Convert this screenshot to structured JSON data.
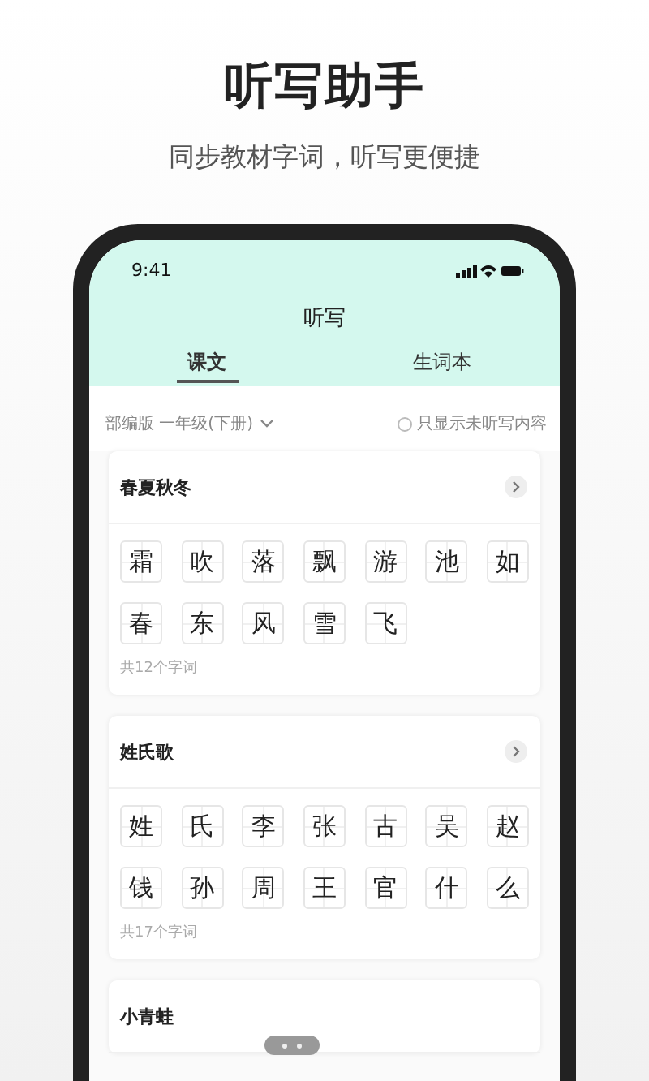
{
  "headline": "听写助手",
  "subheadline": "同步教材字词，听写更便捷",
  "status_bar": {
    "time": "9:41"
  },
  "nav_title": "听写",
  "tabs": [
    {
      "label": "课文",
      "selected": true
    },
    {
      "label": "生词本",
      "selected": false
    }
  ],
  "filter": {
    "textbook": "部编版 一年级(下册)",
    "option_label": "只显示未听写内容",
    "option_checked": false
  },
  "lessons": [
    {
      "title": "春夏秋冬",
      "characters": [
        "霜",
        "吹",
        "落",
        "飘",
        "游",
        "池",
        "如",
        "春",
        "东",
        "风",
        "雪",
        "飞"
      ],
      "count": "共12个字词"
    },
    {
      "title": "姓氏歌",
      "characters": [
        "姓",
        "氏",
        "李",
        "张",
        "古",
        "吴",
        "赵",
        "钱",
        "孙",
        "周",
        "王",
        "官",
        "什",
        "么"
      ],
      "count": "共17个字词"
    },
    {
      "title": "小青蛙"
    }
  ]
}
